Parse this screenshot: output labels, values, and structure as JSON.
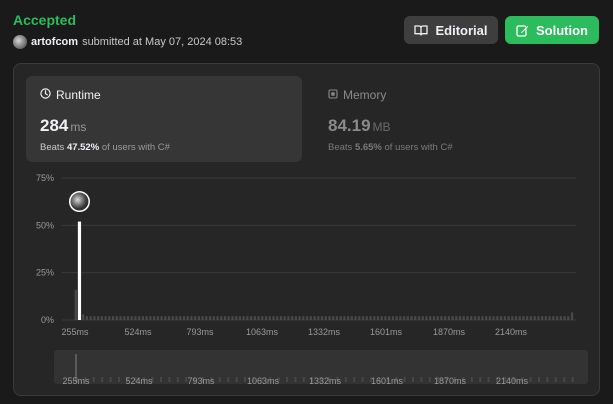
{
  "status": "Accepted",
  "submission": {
    "user": "artofcom",
    "text": "submitted at May 07, 2024 08:53"
  },
  "buttons": {
    "editorial": "Editorial",
    "solution": "Solution"
  },
  "runtime": {
    "title": "Runtime",
    "value": "284",
    "unit": "ms",
    "beats_prefix": "Beats",
    "beats_pct": "47.52%",
    "beats_suffix": "of users with C#"
  },
  "memory": {
    "title": "Memory",
    "value": "84.19",
    "unit": "MB",
    "beats_prefix": "Beats",
    "beats_pct": "5.65%",
    "beats_suffix": "of users with C#"
  },
  "colors": {
    "accepted": "#2cbb5d",
    "solution_button": "#2cbb5d",
    "highlight_bar": "#ffffff",
    "bar": "#4a4a4a"
  },
  "icons": {
    "editorial": "book-icon",
    "solution": "edit-icon",
    "runtime": "clock-icon",
    "memory": "chip-icon"
  },
  "chart_data": {
    "type": "bar",
    "y_ticks": [
      "0%",
      "25%",
      "50%",
      "75%"
    ],
    "ylim": [
      0,
      75
    ],
    "x_ticks": [
      "255ms",
      "524ms",
      "793ms",
      "1063ms",
      "1332ms",
      "1601ms",
      "1870ms",
      "2140ms"
    ],
    "values": [
      0,
      16,
      52,
      3,
      2,
      2,
      2,
      2,
      2,
      2,
      2,
      2,
      2,
      2,
      2,
      2,
      2,
      2,
      2,
      2,
      2,
      2,
      2,
      2,
      2,
      2,
      2,
      2,
      2,
      2,
      2,
      2,
      2,
      2,
      2,
      2,
      2,
      2,
      2,
      2,
      2,
      2,
      2,
      2,
      2,
      2,
      2,
      2,
      2,
      2,
      2,
      2,
      2,
      2,
      2,
      2,
      2,
      2,
      2,
      2,
      2,
      2,
      2,
      2,
      2,
      2,
      2,
      2,
      2,
      2,
      2,
      2,
      2,
      2,
      2,
      2,
      2,
      2,
      2,
      2,
      2,
      2,
      2,
      2,
      2,
      2,
      2,
      2,
      2,
      2,
      2,
      2,
      2,
      2,
      2,
      2,
      2,
      2,
      2,
      2,
      2,
      2,
      2,
      2,
      2,
      2,
      2,
      2,
      2,
      2,
      2,
      2,
      2,
      2,
      2,
      2,
      2,
      2,
      2,
      2,
      2,
      2,
      2,
      2,
      2,
      2,
      2,
      2,
      2,
      2,
      2,
      2,
      2,
      2,
      4
    ],
    "highlight_index": 2,
    "grid": true,
    "navigator": true
  }
}
